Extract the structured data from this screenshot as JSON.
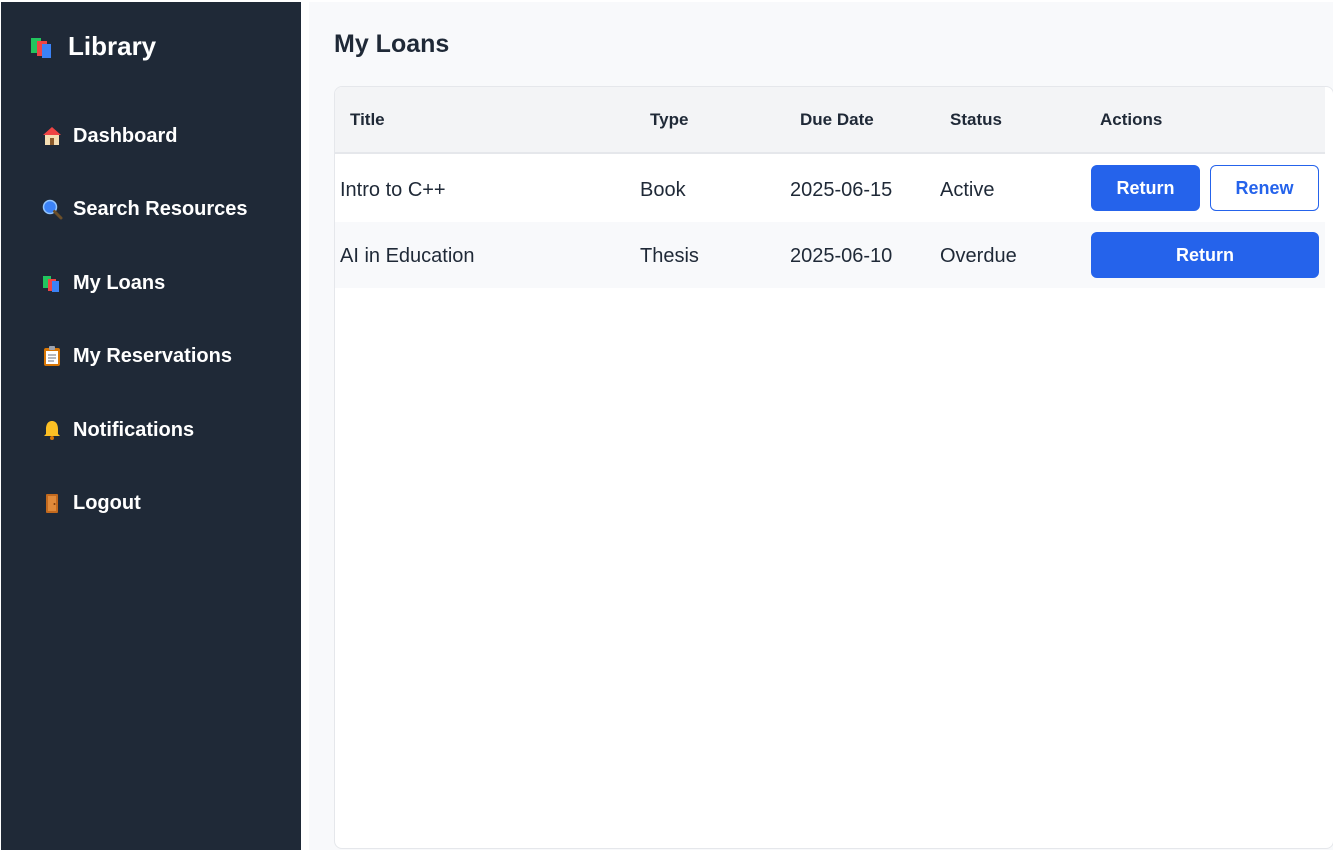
{
  "brand": {
    "title": "Library"
  },
  "sidebar": {
    "items": [
      {
        "label": "Dashboard",
        "icon": "house-icon"
      },
      {
        "label": "Search Resources",
        "icon": "magnifier-icon"
      },
      {
        "label": "My Loans",
        "icon": "books-icon"
      },
      {
        "label": "My Reservations",
        "icon": "clipboard-icon"
      },
      {
        "label": "Notifications",
        "icon": "bell-icon"
      },
      {
        "label": "Logout",
        "icon": "door-icon"
      }
    ]
  },
  "main": {
    "title": "My Loans",
    "table": {
      "headers": [
        "Title",
        "Type",
        "Due Date",
        "Status",
        "Actions"
      ],
      "rows": [
        {
          "title": "Intro to C++",
          "type": "Book",
          "due": "2025-06-15",
          "status": "Active",
          "return_label": "Return",
          "renew_label": "Renew"
        },
        {
          "title": "AI in Education",
          "type": "Thesis",
          "due": "2025-06-10",
          "status": "Overdue",
          "return_label": "Return"
        }
      ]
    }
  },
  "colors": {
    "sidebar_bg": "#1f2937",
    "accent": "#2563eb",
    "text": "#1f2937"
  }
}
